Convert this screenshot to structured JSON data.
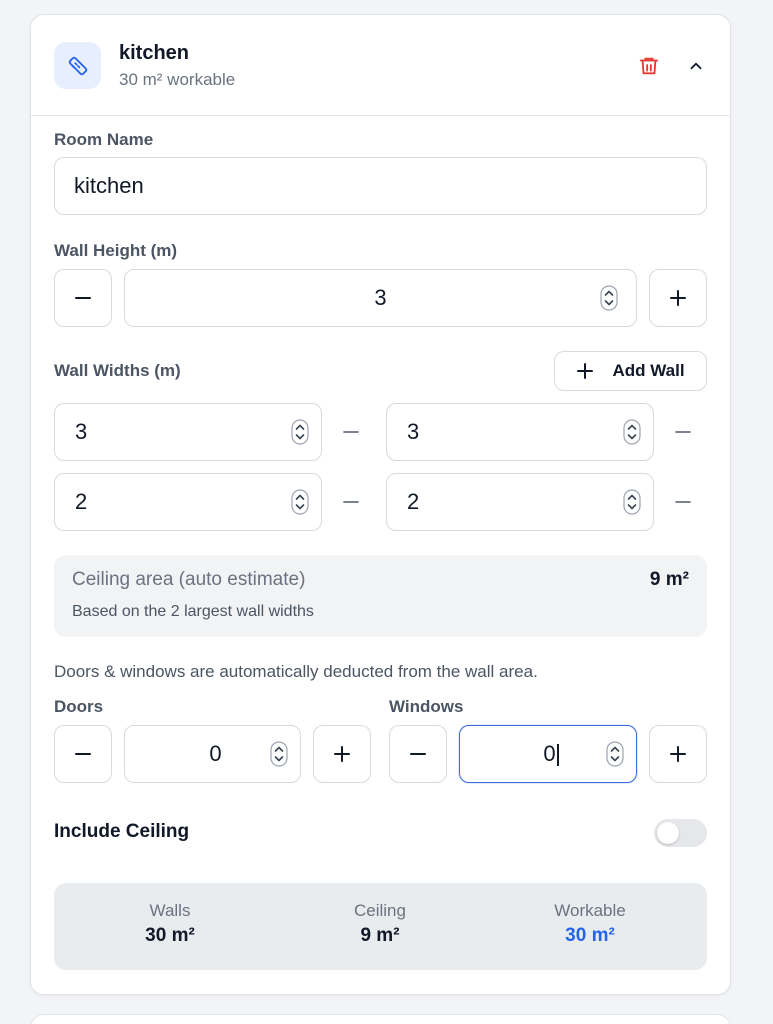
{
  "header": {
    "title": "kitchen",
    "subtitle": "30 m² workable",
    "icon": "ruler-icon",
    "delete_icon": "trash-icon",
    "collapse_icon": "chevron-up-icon"
  },
  "room_name": {
    "label": "Room Name",
    "value": "kitchen"
  },
  "wall_height": {
    "label": "Wall Height (m)",
    "value": "3",
    "decrement": "−",
    "increment": "+"
  },
  "wall_widths": {
    "label": "Wall Widths (m)",
    "add_label": "Add Wall",
    "walls": [
      "3",
      "3",
      "2",
      "2"
    ],
    "remove_symbol": "−"
  },
  "ceiling": {
    "title": "Ceiling area (auto estimate)",
    "value": "9 m²",
    "note": "Based on the 2 largest wall widths"
  },
  "openings_note": "Doors & windows are automatically deducted from the wall area.",
  "doors": {
    "label": "Doors",
    "value": "0"
  },
  "windows": {
    "label": "Windows",
    "value": "0"
  },
  "include_ceiling": {
    "label": "Include Ceiling",
    "enabled": false
  },
  "summary": {
    "walls": {
      "label": "Walls",
      "value": "30 m²"
    },
    "ceiling": {
      "label": "Ceiling",
      "value": "9 m²"
    },
    "workable": {
      "label": "Workable",
      "value": "30 m²"
    }
  },
  "colors": {
    "accent": "#2563eb",
    "danger": "#e53935",
    "icon_bg": "#e7efff",
    "panel_bg": "#f1f3f5",
    "summary_bg": "#e9ecef"
  }
}
